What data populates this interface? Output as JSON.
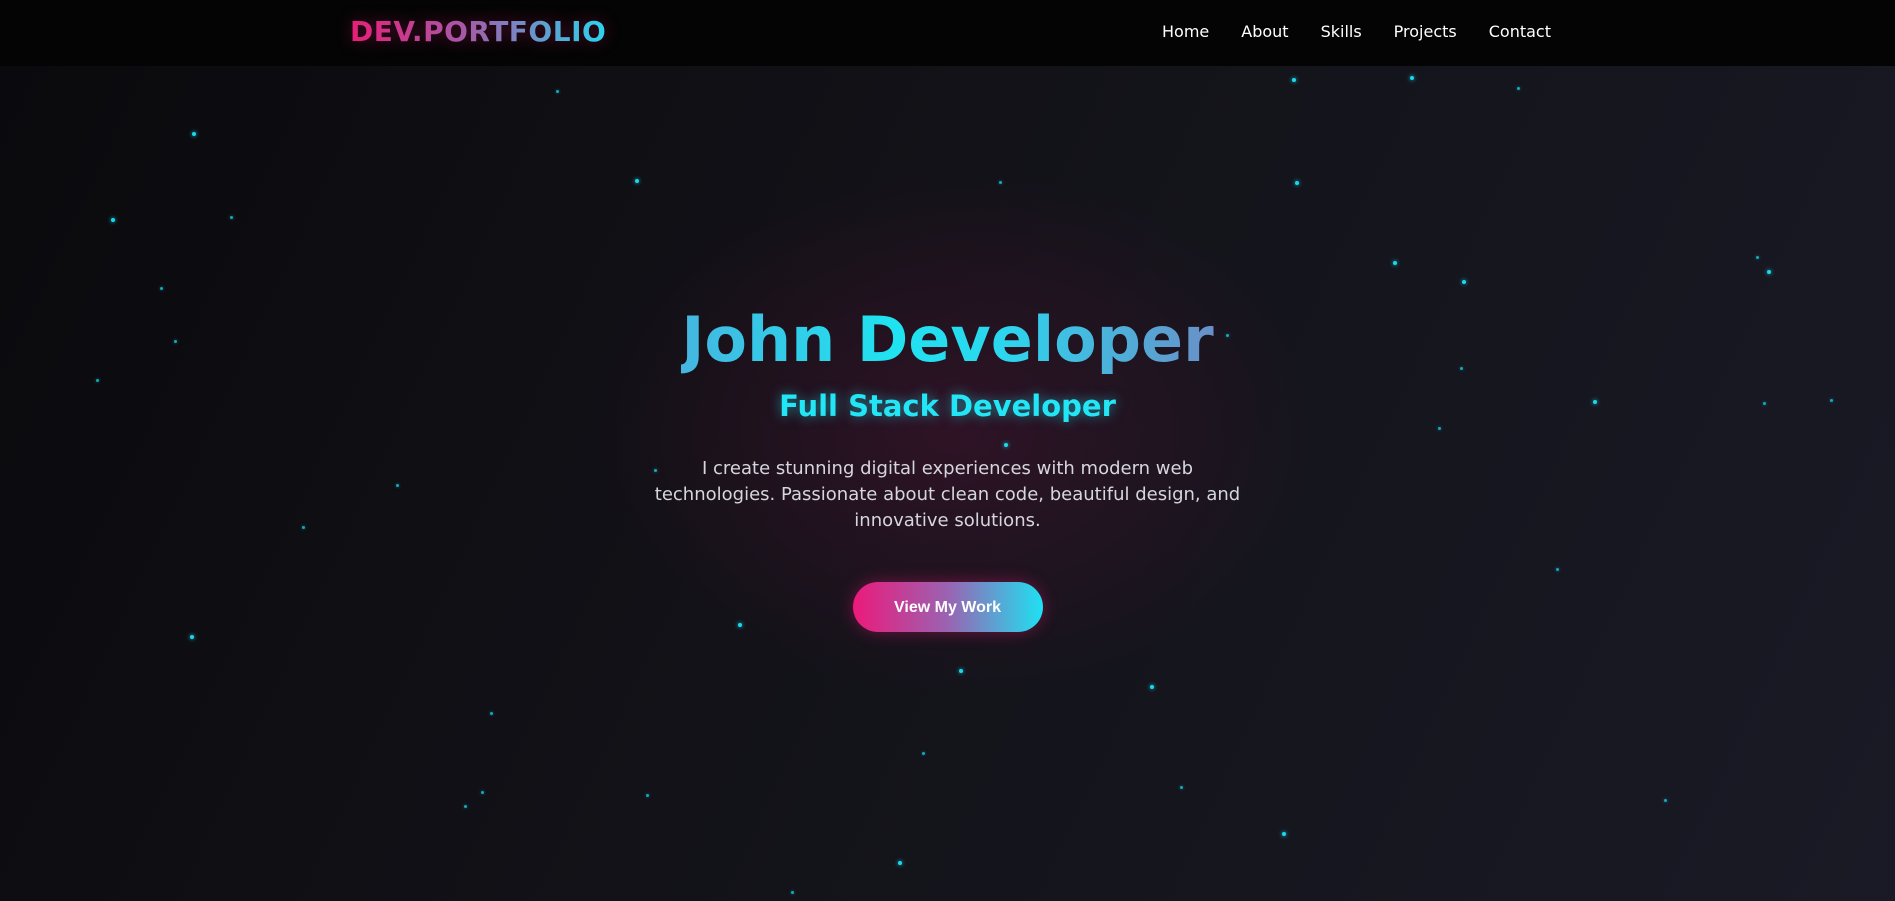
{
  "nav": {
    "logo": "DEV.PORTFOLIO",
    "links": [
      "Home",
      "About",
      "Skills",
      "Projects",
      "Contact"
    ]
  },
  "hero": {
    "name": "John Developer",
    "role": "Full Stack Developer",
    "description": "I create stunning digital experiences with modern web technologies. Passionate about clean code, beautiful design, and innovative solutions.",
    "cta_label": "View My Work"
  },
  "theme": {
    "background": "#0c0c10",
    "accent_pink": "#e91e78",
    "accent_cyan": "#1fe3f0",
    "particle_color": "#19d9ee"
  }
}
